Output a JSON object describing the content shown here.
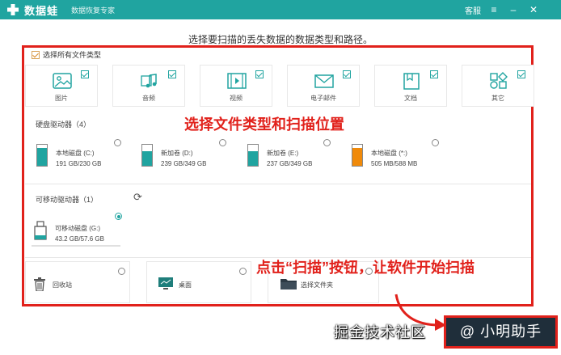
{
  "titlebar": {
    "app_name": "数据蛙",
    "app_subtitle": "数据恢复专家",
    "support": "客服",
    "menu_icon": "hamburger-icon",
    "minimize_icon": "minimize-icon",
    "close_icon": "close-icon"
  },
  "prompt": "选择要扫描的丢失数据的数据类型和路径。",
  "select_all": "选择所有文件类型",
  "file_types": [
    {
      "label": "图片",
      "icon": "image-icon",
      "checked": true
    },
    {
      "label": "音频",
      "icon": "music-icon",
      "checked": true
    },
    {
      "label": "视频",
      "icon": "video-icon",
      "checked": true
    },
    {
      "label": "电子邮件",
      "icon": "mail-icon",
      "checked": true
    },
    {
      "label": "文档",
      "icon": "document-icon",
      "checked": true
    },
    {
      "label": "其它",
      "icon": "other-icon",
      "checked": true
    }
  ],
  "annotations": {
    "choose": "选择文件类型和扫描位置",
    "scan": "点击“扫描”按钮，让软件开始扫描"
  },
  "hard_drives": {
    "title": "硬盘驱动器（4）",
    "items": [
      {
        "name": "本地磁盘 (C:)",
        "size": "191 GB/230 GB",
        "fill": 0.83,
        "color": "#20a4a0"
      },
      {
        "name": "新加卷 (D:)",
        "size": "239 GB/349 GB",
        "fill": 0.68,
        "color": "#20a4a0"
      },
      {
        "name": "新加卷 (E:)",
        "size": "237 GB/349 GB",
        "fill": 0.68,
        "color": "#20a4a0"
      },
      {
        "name": "本地磁盘 (*:)",
        "size": "505 MB/588 MB",
        "fill": 0.86,
        "color": "#f08a0a"
      }
    ]
  },
  "removable": {
    "title": "可移动驱动器（1）",
    "refresh_icon": "refresh-icon",
    "items": [
      {
        "name": "可移动磁盘 (G:)",
        "size": "43.2 GB/57.6 GB",
        "selected": true
      }
    ]
  },
  "locations": [
    {
      "label": "回收站",
      "icon": "trash-icon"
    },
    {
      "label": "桌面",
      "icon": "desktop-icon"
    },
    {
      "label": "选择文件夹",
      "icon": "folder-icon"
    }
  ],
  "watermark": {
    "left": "掘金技术社区",
    "right": "@ 小明助手"
  },
  "colors": {
    "accent": "#20a4a0",
    "highlight": "#e1211b",
    "orange": "#f08a0a"
  }
}
